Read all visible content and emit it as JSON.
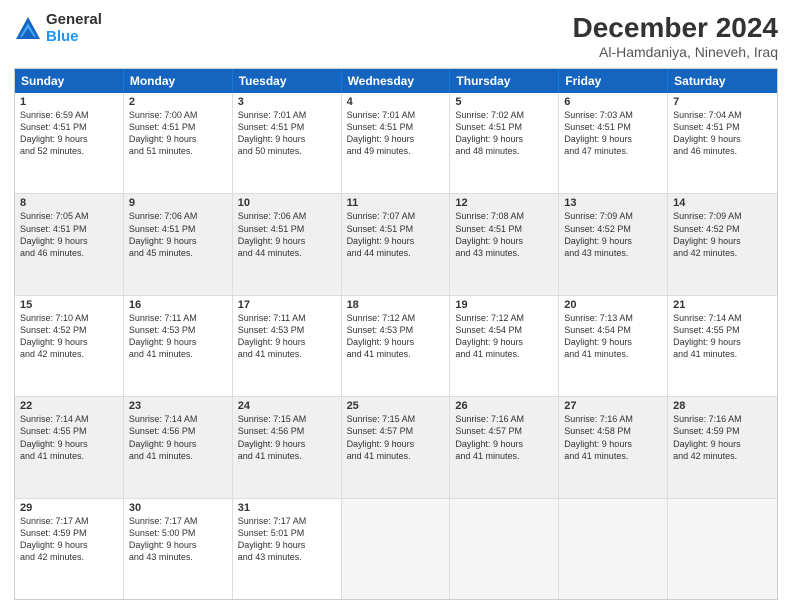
{
  "header": {
    "logo_general": "General",
    "logo_blue": "Blue",
    "title": "December 2024",
    "location": "Al-Hamdaniya, Nineveh, Iraq"
  },
  "weekdays": [
    "Sunday",
    "Monday",
    "Tuesday",
    "Wednesday",
    "Thursday",
    "Friday",
    "Saturday"
  ],
  "rows": [
    [
      {
        "day": "1",
        "lines": [
          "Sunrise: 6:59 AM",
          "Sunset: 4:51 PM",
          "Daylight: 9 hours",
          "and 52 minutes."
        ]
      },
      {
        "day": "2",
        "lines": [
          "Sunrise: 7:00 AM",
          "Sunset: 4:51 PM",
          "Daylight: 9 hours",
          "and 51 minutes."
        ]
      },
      {
        "day": "3",
        "lines": [
          "Sunrise: 7:01 AM",
          "Sunset: 4:51 PM",
          "Daylight: 9 hours",
          "and 50 minutes."
        ]
      },
      {
        "day": "4",
        "lines": [
          "Sunrise: 7:01 AM",
          "Sunset: 4:51 PM",
          "Daylight: 9 hours",
          "and 49 minutes."
        ]
      },
      {
        "day": "5",
        "lines": [
          "Sunrise: 7:02 AM",
          "Sunset: 4:51 PM",
          "Daylight: 9 hours",
          "and 48 minutes."
        ]
      },
      {
        "day": "6",
        "lines": [
          "Sunrise: 7:03 AM",
          "Sunset: 4:51 PM",
          "Daylight: 9 hours",
          "and 47 minutes."
        ]
      },
      {
        "day": "7",
        "lines": [
          "Sunrise: 7:04 AM",
          "Sunset: 4:51 PM",
          "Daylight: 9 hours",
          "and 46 minutes."
        ]
      }
    ],
    [
      {
        "day": "8",
        "lines": [
          "Sunrise: 7:05 AM",
          "Sunset: 4:51 PM",
          "Daylight: 9 hours",
          "and 46 minutes."
        ]
      },
      {
        "day": "9",
        "lines": [
          "Sunrise: 7:06 AM",
          "Sunset: 4:51 PM",
          "Daylight: 9 hours",
          "and 45 minutes."
        ]
      },
      {
        "day": "10",
        "lines": [
          "Sunrise: 7:06 AM",
          "Sunset: 4:51 PM",
          "Daylight: 9 hours",
          "and 44 minutes."
        ]
      },
      {
        "day": "11",
        "lines": [
          "Sunrise: 7:07 AM",
          "Sunset: 4:51 PM",
          "Daylight: 9 hours",
          "and 44 minutes."
        ]
      },
      {
        "day": "12",
        "lines": [
          "Sunrise: 7:08 AM",
          "Sunset: 4:51 PM",
          "Daylight: 9 hours",
          "and 43 minutes."
        ]
      },
      {
        "day": "13",
        "lines": [
          "Sunrise: 7:09 AM",
          "Sunset: 4:52 PM",
          "Daylight: 9 hours",
          "and 43 minutes."
        ]
      },
      {
        "day": "14",
        "lines": [
          "Sunrise: 7:09 AM",
          "Sunset: 4:52 PM",
          "Daylight: 9 hours",
          "and 42 minutes."
        ]
      }
    ],
    [
      {
        "day": "15",
        "lines": [
          "Sunrise: 7:10 AM",
          "Sunset: 4:52 PM",
          "Daylight: 9 hours",
          "and 42 minutes."
        ]
      },
      {
        "day": "16",
        "lines": [
          "Sunrise: 7:11 AM",
          "Sunset: 4:53 PM",
          "Daylight: 9 hours",
          "and 41 minutes."
        ]
      },
      {
        "day": "17",
        "lines": [
          "Sunrise: 7:11 AM",
          "Sunset: 4:53 PM",
          "Daylight: 9 hours",
          "and 41 minutes."
        ]
      },
      {
        "day": "18",
        "lines": [
          "Sunrise: 7:12 AM",
          "Sunset: 4:53 PM",
          "Daylight: 9 hours",
          "and 41 minutes."
        ]
      },
      {
        "day": "19",
        "lines": [
          "Sunrise: 7:12 AM",
          "Sunset: 4:54 PM",
          "Daylight: 9 hours",
          "and 41 minutes."
        ]
      },
      {
        "day": "20",
        "lines": [
          "Sunrise: 7:13 AM",
          "Sunset: 4:54 PM",
          "Daylight: 9 hours",
          "and 41 minutes."
        ]
      },
      {
        "day": "21",
        "lines": [
          "Sunrise: 7:14 AM",
          "Sunset: 4:55 PM",
          "Daylight: 9 hours",
          "and 41 minutes."
        ]
      }
    ],
    [
      {
        "day": "22",
        "lines": [
          "Sunrise: 7:14 AM",
          "Sunset: 4:55 PM",
          "Daylight: 9 hours",
          "and 41 minutes."
        ]
      },
      {
        "day": "23",
        "lines": [
          "Sunrise: 7:14 AM",
          "Sunset: 4:56 PM",
          "Daylight: 9 hours",
          "and 41 minutes."
        ]
      },
      {
        "day": "24",
        "lines": [
          "Sunrise: 7:15 AM",
          "Sunset: 4:56 PM",
          "Daylight: 9 hours",
          "and 41 minutes."
        ]
      },
      {
        "day": "25",
        "lines": [
          "Sunrise: 7:15 AM",
          "Sunset: 4:57 PM",
          "Daylight: 9 hours",
          "and 41 minutes."
        ]
      },
      {
        "day": "26",
        "lines": [
          "Sunrise: 7:16 AM",
          "Sunset: 4:57 PM",
          "Daylight: 9 hours",
          "and 41 minutes."
        ]
      },
      {
        "day": "27",
        "lines": [
          "Sunrise: 7:16 AM",
          "Sunset: 4:58 PM",
          "Daylight: 9 hours",
          "and 41 minutes."
        ]
      },
      {
        "day": "28",
        "lines": [
          "Sunrise: 7:16 AM",
          "Sunset: 4:59 PM",
          "Daylight: 9 hours",
          "and 42 minutes."
        ]
      }
    ],
    [
      {
        "day": "29",
        "lines": [
          "Sunrise: 7:17 AM",
          "Sunset: 4:59 PM",
          "Daylight: 9 hours",
          "and 42 minutes."
        ]
      },
      {
        "day": "30",
        "lines": [
          "Sunrise: 7:17 AM",
          "Sunset: 5:00 PM",
          "Daylight: 9 hours",
          "and 43 minutes."
        ]
      },
      {
        "day": "31",
        "lines": [
          "Sunrise: 7:17 AM",
          "Sunset: 5:01 PM",
          "Daylight: 9 hours",
          "and 43 minutes."
        ]
      },
      {
        "day": "",
        "lines": []
      },
      {
        "day": "",
        "lines": []
      },
      {
        "day": "",
        "lines": []
      },
      {
        "day": "",
        "lines": []
      }
    ]
  ]
}
